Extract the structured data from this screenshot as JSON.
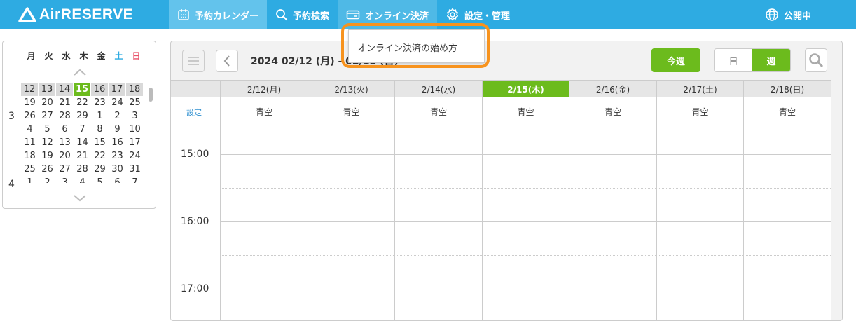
{
  "header": {
    "logo": "AirRESERVE",
    "nav": [
      {
        "label": "予約カレンダー",
        "icon": "calendar-icon"
      },
      {
        "label": "予約検索",
        "icon": "search-icon"
      },
      {
        "label": "オンライン決済",
        "icon": "card-icon"
      },
      {
        "label": "設定・管理",
        "icon": "gear-icon"
      }
    ],
    "public_label": "公開中"
  },
  "dropdown": {
    "item": "オンライン決済の始め方"
  },
  "mini_calendar": {
    "weekdays": [
      "月",
      "火",
      "水",
      "木",
      "金",
      "土",
      "日"
    ],
    "current_week": [
      "12",
      "13",
      "14",
      "15",
      "16",
      "17",
      "18"
    ],
    "rows": [
      [
        "19",
        "20",
        "21",
        "22",
        "23",
        "24",
        "25"
      ],
      [
        "26",
        "27",
        "28",
        "29",
        "1",
        "2",
        "3"
      ],
      [
        "4",
        "5",
        "6",
        "7",
        "8",
        "9",
        "10"
      ],
      [
        "11",
        "12",
        "13",
        "14",
        "15",
        "16",
        "17"
      ],
      [
        "18",
        "19",
        "20",
        "21",
        "22",
        "23",
        "24"
      ],
      [
        "25",
        "26",
        "27",
        "28",
        "29",
        "30",
        "31"
      ],
      [
        "1",
        "2",
        "3",
        "4",
        "5",
        "6",
        "7"
      ]
    ],
    "month_labels": [
      "3",
      "4"
    ]
  },
  "toolbar": {
    "date_range": "2024 02/12 (月) - 02/18 (日)",
    "today_label": "今週",
    "day_label": "日",
    "week_label": "週"
  },
  "grid": {
    "days": [
      "2/12(月)",
      "2/13(火)",
      "2/14(水)",
      "2/15(木)",
      "2/16(金)",
      "2/17(土)",
      "2/18(日)"
    ],
    "settings_label": "設定",
    "staff": "青空",
    "times": [
      "15:00",
      "16:00",
      "17:00"
    ]
  },
  "colors": {
    "brand": "#2eabe2",
    "accent": "#6cbb1d",
    "highlight": "#f7931e"
  }
}
